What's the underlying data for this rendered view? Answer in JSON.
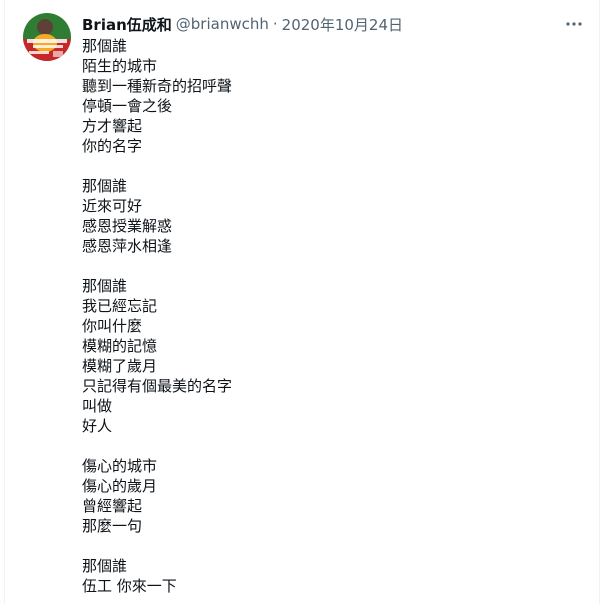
{
  "tweet": {
    "author": {
      "display_name": "Brian伍成和",
      "handle": "@brianwchh",
      "avatar_icon": "profile-photo-icon"
    },
    "separator": "·",
    "timestamp": "2020年10月24日",
    "more_icon": "more-horizontal-icon",
    "lines": [
      "那個誰",
      "陌生的城市",
      "聽到一種新奇的招呼聲",
      "停頓一會之後",
      "方才響起",
      "你的名字",
      "",
      "那個誰",
      "近來可好",
      "感恩授業解惑",
      "感恩萍水相逢",
      "",
      "那個誰",
      "我已經忘記",
      "你叫什麼",
      "模糊的記憶",
      "模糊了歲月",
      "只記得有個最美的名字",
      "叫做",
      "好人",
      "",
      "傷心的城市",
      "傷心的歲月",
      "曾經響起",
      "那麼一句",
      "",
      "那個誰",
      "伍工 你來一下"
    ]
  },
  "colors": {
    "text_primary": "#0f1419",
    "text_secondary": "#536471",
    "border": "#eff3f4"
  }
}
